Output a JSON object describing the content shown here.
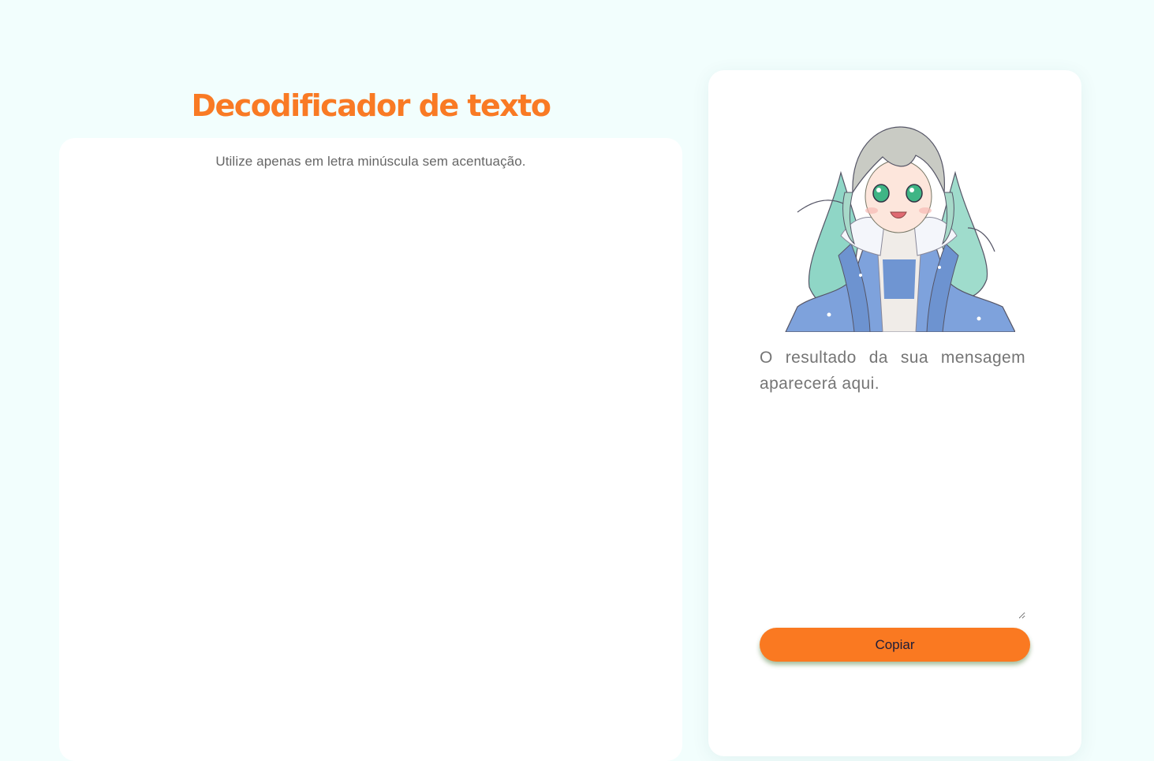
{
  "header": {
    "title": "Decodificador de texto"
  },
  "input_panel": {
    "hint": "Utilize apenas em letra minúscula sem acentuação.",
    "textarea_value": ""
  },
  "output_panel": {
    "image_name": "anime-girl-illustration",
    "placeholder": "O resultado da sua mensagem aparecerá aqui.",
    "copy_label": "Copiar"
  },
  "colors": {
    "accent": "#fa7921",
    "background": "#f2fefd",
    "card": "#ffffff",
    "muted_text": "#6b6b6b"
  }
}
